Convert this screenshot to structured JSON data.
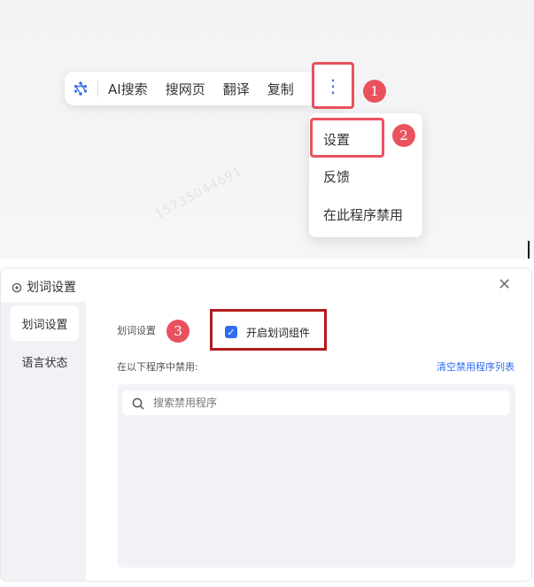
{
  "toolbar": {
    "logo_icon": "hexagon-ai-logo-icon",
    "items": [
      "AI搜索",
      "搜网页",
      "翻译",
      "复制"
    ],
    "more_icon": "vertical-ellipsis-icon"
  },
  "menu": {
    "items": [
      "设置",
      "反馈",
      "在此程序禁用"
    ]
  },
  "watermark": "15735044691",
  "annotations": {
    "step1": "1",
    "step2": "2",
    "step3": "3",
    "color": "#e9525d"
  },
  "settings": {
    "title": "划词设置",
    "close_icon": "close-icon",
    "sidebar": [
      "划词设置",
      "语言状态"
    ],
    "section_label": "划词设置",
    "checkbox_label": "开启划词组件",
    "checkbox_checked": true,
    "disabled_label": "在以下程序中禁用:",
    "clear_link": "清空禁用程序列表",
    "search_placeholder": "搜索禁用程序",
    "accent_color": "#2f6ef2"
  }
}
